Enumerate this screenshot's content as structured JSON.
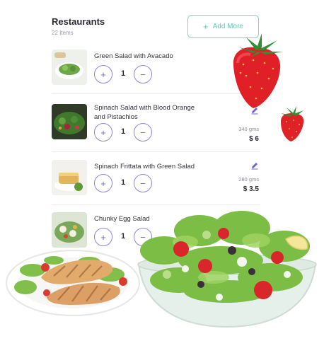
{
  "header": {
    "title": "Restaurants",
    "count": "22 Items"
  },
  "add_button": {
    "label": "Add More",
    "icon": "plus-icon"
  },
  "items": [
    {
      "name": "Green Salad with Avacado",
      "qty": "1",
      "weight": "",
      "price": ""
    },
    {
      "name": "Spinach Salad with Blood Orange and Pistachios",
      "qty": "1",
      "weight": "340 gms",
      "price": "$ 6"
    },
    {
      "name": "Spinach Frittata with Green Salad",
      "qty": "1",
      "weight": "280 gms",
      "price": "$ 3.5"
    },
    {
      "name": "Chunky Egg Salad",
      "qty": "1",
      "weight": "",
      "price": ""
    }
  ],
  "stepper": {
    "plus": "+",
    "minus": "−"
  },
  "colors": {
    "accent": "#7dd6c8",
    "stepper": "#8e86d8",
    "edit": "#6f64cc"
  }
}
